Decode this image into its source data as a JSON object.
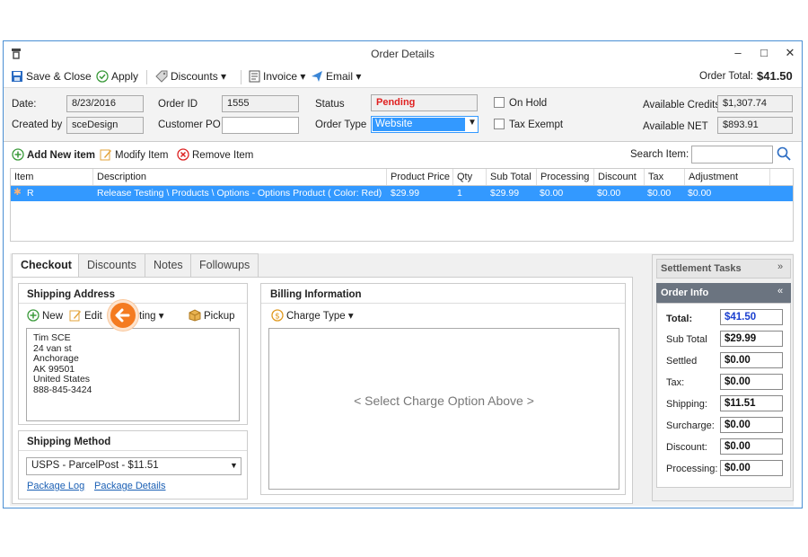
{
  "window": {
    "title": "Order Details",
    "minimize": "–",
    "maximize": "□",
    "close": "✕"
  },
  "toolbar": {
    "save_close": "Save & Close",
    "apply": "Apply",
    "discounts": "Discounts",
    "invoice": "Invoice",
    "email": "Email",
    "order_total_label": "Order Total:",
    "order_total_value": "$41.50"
  },
  "header": {
    "date_label": "Date:",
    "date_value": "8/23/2016",
    "order_id_label": "Order ID",
    "order_id_value": "1555",
    "status_label": "Status",
    "status_value": "Pending",
    "on_hold_label": "On Hold",
    "available_credits_label": "Available Credits",
    "available_credits_value": "$1,307.74",
    "created_by_label": "Created by",
    "created_by_value": "sceDesign",
    "customer_po_label": "Customer PO",
    "customer_po_value": "",
    "order_type_label": "Order Type",
    "order_type_value": "Website",
    "tax_exempt_label": "Tax Exempt",
    "available_net_label": "Available NET",
    "available_net_value": "$893.91"
  },
  "items_bar": {
    "add_item": "Add New item",
    "modify_item": "Modify Item",
    "remove_item": "Remove Item",
    "search_label": "Search Item:"
  },
  "grid": {
    "columns": [
      "Item",
      "Description",
      "Product Price",
      "Qty",
      "Sub Total",
      "Processing",
      "Discount",
      "Tax",
      "Adjustment"
    ],
    "rows": [
      {
        "item": "R",
        "description": "Release Testing \\ Products \\ Options - Options Product ( Color: Red)",
        "price": "$29.99",
        "qty": "1",
        "subtotal": "$29.99",
        "processing": "$0.00",
        "discount": "$0.00",
        "tax": "$0.00",
        "adjustment": "$0.00"
      }
    ]
  },
  "tabs": [
    "Checkout",
    "Discounts",
    "Notes",
    "Followups"
  ],
  "shipping_address": {
    "title": "Shipping Address",
    "new": "New",
    "edit": "Edit",
    "more": "ting",
    "pickup": "Pickup",
    "lines": [
      "Tim SCE",
      "24 van st",
      "Anchorage",
      "AK 99501",
      "United States",
      "888-845-3424"
    ]
  },
  "shipping_method": {
    "title": "Shipping Method",
    "selected": "USPS - ParcelPost - $11.51",
    "package_log": "Package Log",
    "package_details": "Package Details"
  },
  "billing": {
    "title": "Billing Information",
    "charge_type": "Charge Type",
    "placeholder": "< Select Charge Option Above >"
  },
  "settlement": {
    "title": "Settlement Tasks"
  },
  "order_info": {
    "title": "Order Info",
    "rows": [
      {
        "label": "Total:",
        "value": "$41.50"
      },
      {
        "label": "Sub Total",
        "value": "$29.99"
      },
      {
        "label": "Settled",
        "value": "$0.00"
      },
      {
        "label": "Tax:",
        "value": "$0.00"
      },
      {
        "label": "Shipping:",
        "value": "$11.51"
      },
      {
        "label": "Surcharge:",
        "value": "$0.00"
      },
      {
        "label": "Discount:",
        "value": "$0.00"
      },
      {
        "label": "Processing:",
        "value": "$0.00"
      }
    ]
  },
  "colors": {
    "accent": "#3399ff",
    "pending": "#e02020",
    "callout": "#f47b20",
    "link": "#1a5fb4"
  }
}
